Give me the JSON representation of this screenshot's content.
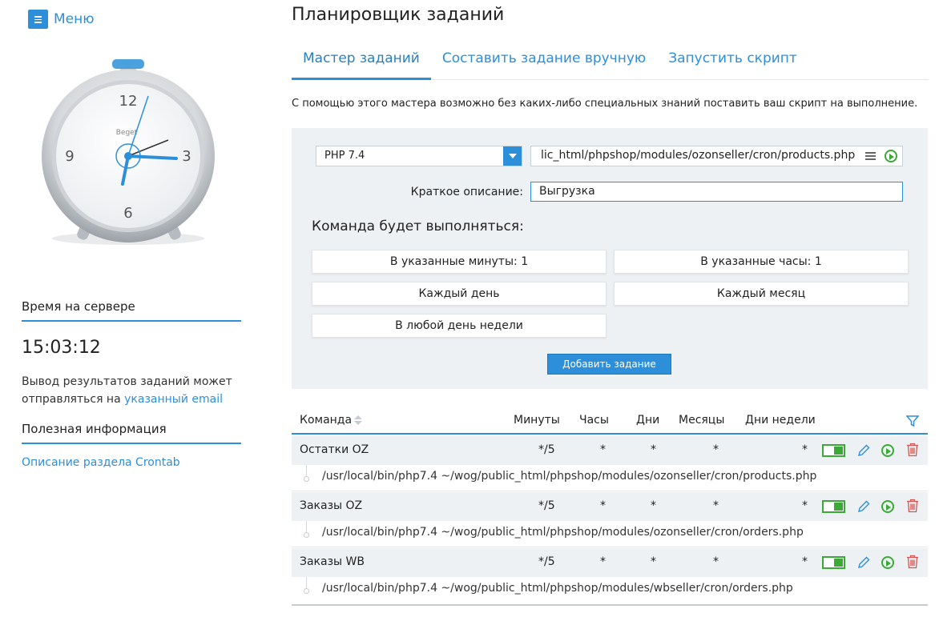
{
  "sidebar": {
    "menu_label": "Меню",
    "clock": {
      "brand": "Beget",
      "numerals": [
        "12",
        "3",
        "6",
        "9"
      ]
    },
    "time_heading": "Время на сервере",
    "server_time": "15:03:12",
    "output_note_text": "Вывод результатов заданий может отправляться на ",
    "output_note_link": "указанный email",
    "useful_heading": "Полезная информация",
    "crontab_link": "Описание раздела Crontab"
  },
  "header": {
    "title": "Планировщик заданий",
    "tabs": [
      {
        "label": "Мастер заданий",
        "active": true
      },
      {
        "label": "Составить задание вручную",
        "active": false
      },
      {
        "label": "Запустить скрипт",
        "active": false
      }
    ]
  },
  "wizard": {
    "intro": "С помощью этого мастера возможно без каких-либо специальных знаний поставить ваш скрипт на выполнение.",
    "php_version": "PHP 7.4",
    "script_path": "lic_html/phpshop/modules/ozonseller/cron/products.php",
    "description_label": "Краткое описание:",
    "description_value": "Выгрузка",
    "run_heading": "Команда будет выполняться:",
    "schedule": {
      "minutes": "В указанные минуты: 1",
      "hours": "В указанные часы: 1",
      "day": "Каждый день",
      "month": "Каждый месяц",
      "weekday": "В любой день недели"
    },
    "add_button": "Добавить задание"
  },
  "table": {
    "headers": {
      "command": "Команда",
      "minutes": "Минуты",
      "hours": "Часы",
      "days": "Дни",
      "months": "Месяцы",
      "weekdays": "Дни недели"
    },
    "rows": [
      {
        "name": "Остатки OZ",
        "minutes": "*/5",
        "hours": "*",
        "days": "*",
        "months": "*",
        "weekdays": "*",
        "command": "/usr/local/bin/php7.4 ~/wog/public_html/phpshop/modules/ozonseller/cron/products.php"
      },
      {
        "name": "Заказы OZ",
        "minutes": "*/5",
        "hours": "*",
        "days": "*",
        "months": "*",
        "weekdays": "*",
        "command": "/usr/local/bin/php7.4 ~/wog/public_html/phpshop/modules/ozonseller/cron/orders.php"
      },
      {
        "name": "Заказы WB",
        "minutes": "*/5",
        "hours": "*",
        "days": "*",
        "months": "*",
        "weekdays": "*",
        "command": "/usr/local/bin/php7.4 ~/wog/public_html/phpshop/modules/wbseller/cron/orders.php"
      }
    ]
  },
  "colors": {
    "accent": "#2d8fd9",
    "success": "#3aa935",
    "danger": "#d9534f",
    "panel": "#eef1f4"
  }
}
